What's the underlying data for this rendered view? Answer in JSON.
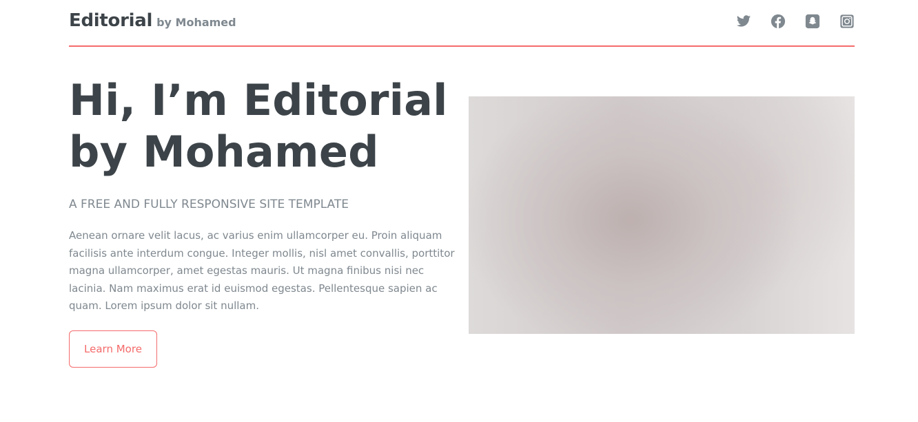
{
  "header": {
    "logo_main": "Editorial",
    "logo_by": "by Mohamed",
    "accent_color": "#f56a6a",
    "social_icons": [
      "twitter-icon",
      "facebook-icon",
      "snapchat-icon",
      "instagram-icon"
    ]
  },
  "banner": {
    "headline_line1": "Hi, I’m Editorial",
    "headline_line2": "by Mohamed",
    "subtitle": "A FREE AND FULLY RESPONSIVE SITE TEMPLATE",
    "body_lines": [
      "Aenean ornare velit lacus, ac varius enim ullamcorper eu. Proin aliquam",
      "facilisis ante interdum congue. Integer mollis, nisl amet convallis, porttitor",
      "magna ullamcorper, amet egestas mauris. Ut magna finibus nisi nec",
      "lacinia. Nam maximus erat id euismod egestas. Pellentesque sapien ac",
      "quam. Lorem ipsum dolor sit nullam."
    ],
    "button_label": "Learn More"
  }
}
